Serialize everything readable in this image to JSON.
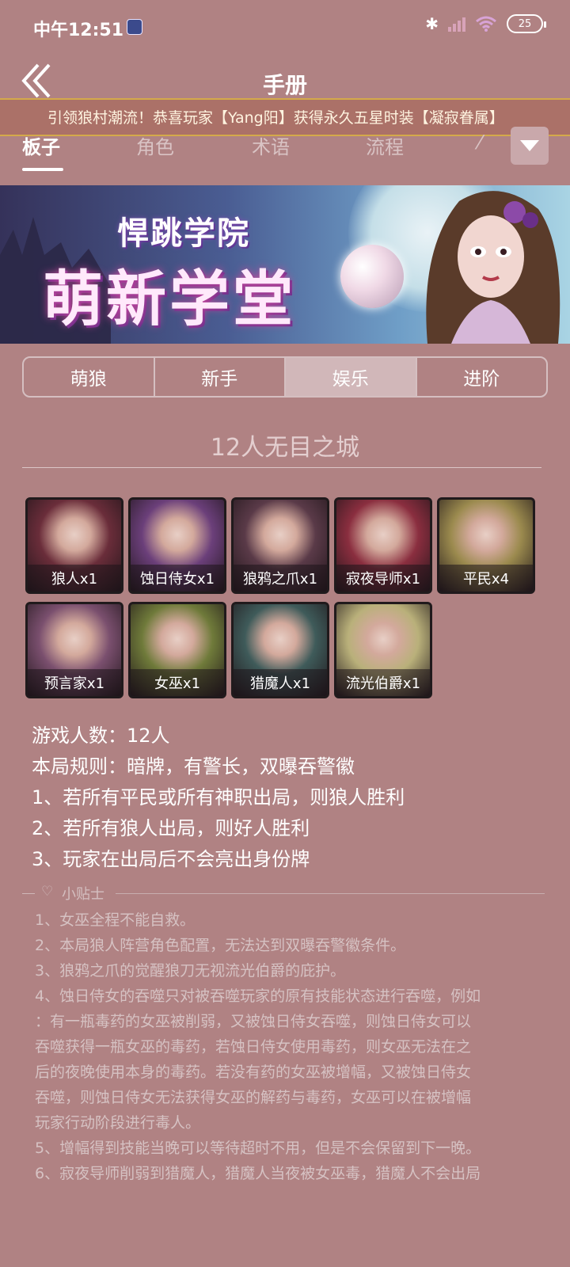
{
  "status_bar": {
    "time": "中午12:51",
    "battery": "25"
  },
  "header": {
    "title": "手册"
  },
  "marquee": {
    "text": "引领狼村潮流！恭喜玩家【Yang阳】获得永久五星时装【凝寂眷属】"
  },
  "tabs": [
    {
      "label": "板子",
      "active": true
    },
    {
      "label": "角色",
      "active": false
    },
    {
      "label": "术语",
      "active": false
    },
    {
      "label": "流程",
      "active": false
    },
    {
      "label": "⁄",
      "active": false
    }
  ],
  "banner": {
    "subtitle": "悍跳学院",
    "title": "萌新学堂"
  },
  "segments": [
    {
      "label": "萌狼",
      "active": false
    },
    {
      "label": "新手",
      "active": false
    },
    {
      "label": "娱乐",
      "active": true
    },
    {
      "label": "进阶",
      "active": false
    }
  ],
  "board": {
    "title": "12人无目之城",
    "roles": [
      {
        "label": "狼人x1",
        "color": "#6a2d3a"
      },
      {
        "label": "蚀日侍女x1",
        "color": "#6b3f7a"
      },
      {
        "label": "狼鸦之爪x1",
        "color": "#5a3a48"
      },
      {
        "label": "寂夜导师x1",
        "color": "#8a2e3f"
      },
      {
        "label": "平民x4",
        "color": "#9b8a4e"
      },
      {
        "label": "预言家x1",
        "color": "#7a4f6e"
      },
      {
        "label": "女巫x1",
        "color": "#6f7a3a"
      },
      {
        "label": "猎魔人x1",
        "color": "#3f5b5a"
      },
      {
        "label": "流光伯爵x1",
        "color": "#b9b07a"
      }
    ],
    "info": [
      "游戏人数：12人",
      "本局规则：暗牌，有警长，双曝吞警徽",
      "1、若所有平民或所有神职出局，则狼人胜利",
      "2、若所有狼人出局，则好人胜利",
      "3、玩家在出局后不会亮出身份牌"
    ]
  },
  "tips": {
    "label": "小贴士",
    "lines": [
      "1、女巫全程不能自救。",
      "2、本局狼人阵营角色配置，无法达到双曝吞警徽条件。",
      "3、狼鸦之爪的觉醒狼刀无视流光伯爵的庇护。",
      "4、蚀日侍女的吞噬只对被吞噬玩家的原有技能状态进行吞噬，例如",
      "：有一瓶毒药的女巫被削弱，又被蚀日侍女吞噬，则蚀日侍女可以",
      "吞噬获得一瓶女巫的毒药，若蚀日侍女使用毒药，则女巫无法在之",
      "后的夜晚使用本身的毒药。若没有药的女巫被增幅，又被蚀日侍女",
      "吞噬，则蚀日侍女无法获得女巫的解药与毒药，女巫可以在被增幅",
      "玩家行动阶段进行毒人。",
      "5、增幅得到技能当晚可以等待超时不用，但是不会保留到下一晚。",
      "6、寂夜导师削弱到猎魔人，猎魔人当夜被女巫毒，猎魔人不会出局"
    ]
  }
}
